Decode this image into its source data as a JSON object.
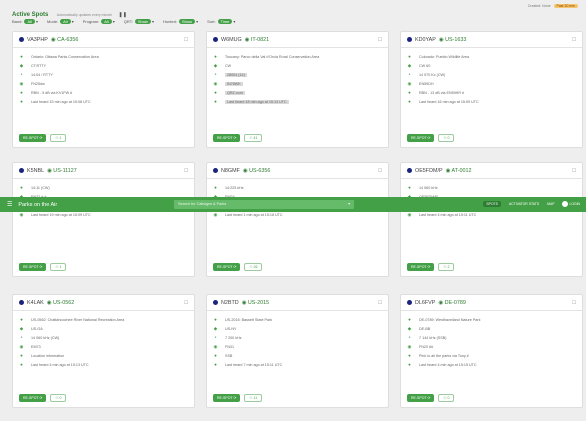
{
  "header": {
    "title": "Active Spots",
    "subtitle": "Automatically updates every minute",
    "pause_icon": "pause-icon",
    "right_text": "Created: None",
    "badge": "Past 30 min"
  },
  "filters": [
    {
      "label": "Band:",
      "value": "All"
    },
    {
      "label": "Mode:",
      "value": "All"
    },
    {
      "label": "Program:",
      "value": "All"
    },
    {
      "label": "QRT:",
      "value": "Show"
    },
    {
      "label": "Hunted:",
      "value": "Show"
    },
    {
      "label": "Sort:",
      "value": "Time"
    }
  ],
  "appbar": {
    "brand": "Parks on the Air",
    "search_placeholder": "Search for Callsigns & Parks",
    "menu": [
      "SPOTS",
      "ACTIVATOR STATS",
      "MAP",
      "LOGIN"
    ]
  },
  "cards": [
    {
      "call": "VA3PHP",
      "ref": "CA-6356",
      "rows": [
        "Ontario: Ottawa Parks Conservation Area",
        "CT:RTTY",
        "14:04 / RTTY",
        "FN25dw",
        "RBN - 9 dB via KV1FW #",
        "Last heard 15 min ago at 15:08 UTC"
      ],
      "hl": [],
      "spot": "RE-SPOT",
      "count": "1"
    },
    {
      "call": "W6MUG",
      "ref": "IT-0821",
      "rows": [
        "Tuscany: Parco della Val d'Orcia Rural Conservation Area",
        "CW",
        "28004 (14)",
        "IN78WK",
        "QRZ.com",
        "Last heard 18 min ago at 15:13 UTC"
      ],
      "hl": [
        2,
        3,
        4,
        5
      ],
      "spot": "RE-SPOT",
      "count": "41"
    },
    {
      "call": "KD0YAP",
      "ref": "US-1633",
      "rows": [
        "Colorado: Pueblo Wildlife Area",
        "CW 60",
        "14 070 Kc (CW)",
        "EN59DH",
        "RBN - 13 dB via EN59HR #",
        "Last heard 16 min ago at 15:09 UTC"
      ],
      "hl": [],
      "spot": "RE-SPOT",
      "count": "0"
    },
    {
      "call": "K5NBL",
      "ref": "US-11127",
      "rows": [
        "14:11 (CW)",
        "EN37 # #",
        "RBN - 21 dB via K9TR #",
        "Last heard 19 min ago at 15:09 UTC"
      ],
      "hl": [],
      "spot": "RE-SPOT",
      "count": "1"
    },
    {
      "call": "N8GMF",
      "ref": "US-6356",
      "rows": [
        "14:225 kHz",
        "EM24",
        "SSB",
        "Last heard 1 min ago at 15:16 UTC"
      ],
      "hl": [],
      "spot": "RE-SPOT",
      "count": "26"
    },
    {
      "call": "OE5FDM/P",
      "ref": "AT-0012",
      "rows": [
        "14 060 kHz",
        "OE5FDM/P",
        "Salzkammergut ARDS Pts",
        "Last heard 4 min ago at 15:11 UTC"
      ],
      "hl": [],
      "spot": "RE-SPOT",
      "count": "2"
    },
    {
      "call": "K4LAK",
      "ref": "US-0562",
      "rows": [
        "US-0562: Chattahoochee River National Recreation Area",
        "US-GA",
        "14 060 kHz (CW)",
        "EM73",
        "Location information",
        "Last heard 4 min ago at 15:13 UTC"
      ],
      "hl": [],
      "spot": "RE-SPOT",
      "count": "0"
    },
    {
      "call": "N2BTD",
      "ref": "US-2015",
      "rows": [
        "US-2015: Bassett State Park",
        "US-NY",
        "7 200 kHz",
        "FN31",
        "SSB",
        "Last heard 7 min ago at 15:11 UTC"
      ],
      "hl": [],
      "spot": "RE-SPOT",
      "count": "11"
    },
    {
      "call": "DL6FVP",
      "ref": "DE-0789",
      "rows": [
        "DE-0789: Westhavelland Nature Park",
        "DE-BB",
        "7 144 kHz (SSB)",
        "FN20 ##",
        "Pink to all the parks via Tony #",
        "Last heard 4 min ago at 15:15 UTC"
      ],
      "hl": [],
      "spot": "RE-SPOT",
      "count": "0"
    }
  ],
  "colors": {
    "accent": "#43a047",
    "dark_accent": "#2e7d32",
    "badge": "#f9c46b"
  }
}
